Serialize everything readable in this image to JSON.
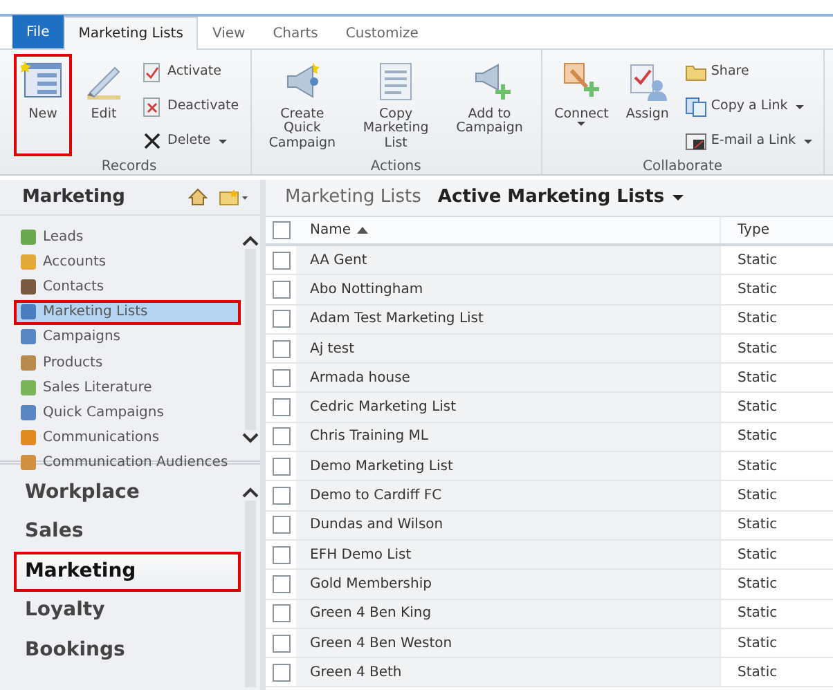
{
  "ribbon": {
    "tabs": [
      {
        "label": "File",
        "kind": "file",
        "selected": false
      },
      {
        "label": "Marketing Lists",
        "kind": "tab",
        "selected": true
      },
      {
        "label": "View",
        "kind": "tab",
        "selected": false
      },
      {
        "label": "Charts",
        "kind": "tab",
        "selected": false
      },
      {
        "label": "Customize",
        "kind": "tab",
        "selected": false
      }
    ],
    "groups": [
      {
        "label": "Records",
        "buttons": [
          {
            "label": "New",
            "kind": "large",
            "dropdown": false,
            "highlighted": true
          },
          {
            "label": "Edit",
            "kind": "large",
            "dropdown": false,
            "highlighted": false
          },
          {
            "label": "Activate",
            "kind": "small",
            "dropdown": false,
            "highlighted": false
          },
          {
            "label": "Deactivate",
            "kind": "small",
            "dropdown": false,
            "highlighted": false
          },
          {
            "label": "Delete",
            "kind": "small",
            "dropdown": true,
            "highlighted": false
          }
        ]
      },
      {
        "label": "Actions",
        "buttons": [
          {
            "label": "Create Quick Campaign",
            "kind": "large",
            "dropdown": false,
            "highlighted": false
          },
          {
            "label": "Copy Marketing List",
            "kind": "large",
            "dropdown": false,
            "highlighted": false
          },
          {
            "label": "Add to Campaign",
            "kind": "large",
            "dropdown": false,
            "highlighted": false
          }
        ]
      },
      {
        "label": "Collaborate",
        "buttons": [
          {
            "label": "Connect",
            "kind": "large",
            "dropdown": true,
            "highlighted": false
          },
          {
            "label": "Assign",
            "kind": "large",
            "dropdown": false,
            "highlighted": false
          },
          {
            "label": "Share",
            "kind": "small",
            "dropdown": false,
            "highlighted": false
          },
          {
            "label": "Copy a Link",
            "kind": "small",
            "dropdown": true,
            "highlighted": false
          },
          {
            "label": "E-mail a Link",
            "kind": "small",
            "dropdown": true,
            "highlighted": false
          }
        ]
      }
    ]
  },
  "nav": {
    "title": "Marketing",
    "items": [
      {
        "label": "Leads",
        "selected": false,
        "highlighted": false
      },
      {
        "label": "Accounts",
        "selected": false,
        "highlighted": false
      },
      {
        "label": "Contacts",
        "selected": false,
        "highlighted": false
      },
      {
        "label": "Marketing Lists",
        "selected": true,
        "highlighted": true
      },
      {
        "label": "Campaigns",
        "selected": false,
        "highlighted": false
      },
      {
        "label": "Products",
        "selected": false,
        "highlighted": false
      },
      {
        "label": "Sales Literature",
        "selected": false,
        "highlighted": false
      },
      {
        "label": "Quick Campaigns",
        "selected": false,
        "highlighted": false
      },
      {
        "label": "Communications",
        "selected": false,
        "highlighted": false
      },
      {
        "label": "Communication Audiences",
        "selected": false,
        "highlighted": false
      }
    ],
    "areas": [
      {
        "label": "Workplace",
        "selected": false,
        "highlighted": false
      },
      {
        "label": "Sales",
        "selected": false,
        "highlighted": false
      },
      {
        "label": "Marketing",
        "selected": true,
        "highlighted": true
      },
      {
        "label": "Loyalty",
        "selected": false,
        "highlighted": false
      },
      {
        "label": "Bookings",
        "selected": false,
        "highlighted": false
      }
    ]
  },
  "grid": {
    "entity": "Marketing Lists",
    "view": "Active Marketing Lists",
    "all_checked": false,
    "columns": [
      {
        "label": "Name",
        "sorted": true
      },
      {
        "label": "Type",
        "sorted": false
      }
    ],
    "rows": [
      {
        "name": "AA Gent",
        "type": "Static",
        "checked": false
      },
      {
        "name": "Abo Nottingham",
        "type": "Static",
        "checked": false
      },
      {
        "name": "Adam Test Marketing List",
        "type": "Static",
        "checked": false
      },
      {
        "name": "Aj test",
        "type": "Static",
        "checked": false
      },
      {
        "name": "Armada house",
        "type": "Static",
        "checked": false
      },
      {
        "name": "Cedric Marketing List",
        "type": "Static",
        "checked": false
      },
      {
        "name": "Chris Training ML",
        "type": "Static",
        "checked": false
      },
      {
        "name": "Demo Marketing List",
        "type": "Static",
        "checked": false
      },
      {
        "name": "Demo to Cardiff FC",
        "type": "Static",
        "checked": false
      },
      {
        "name": "Dundas and Wilson",
        "type": "Static",
        "checked": false
      },
      {
        "name": "EFH Demo List",
        "type": "Static",
        "checked": false
      },
      {
        "name": "Gold Membership",
        "type": "Static",
        "checked": false
      },
      {
        "name": "Green 4 Ben King",
        "type": "Static",
        "checked": false
      },
      {
        "name": "Green 4 Ben Weston",
        "type": "Static",
        "checked": false
      },
      {
        "name": "Green 4 Beth",
        "type": "Static",
        "checked": false
      }
    ]
  }
}
